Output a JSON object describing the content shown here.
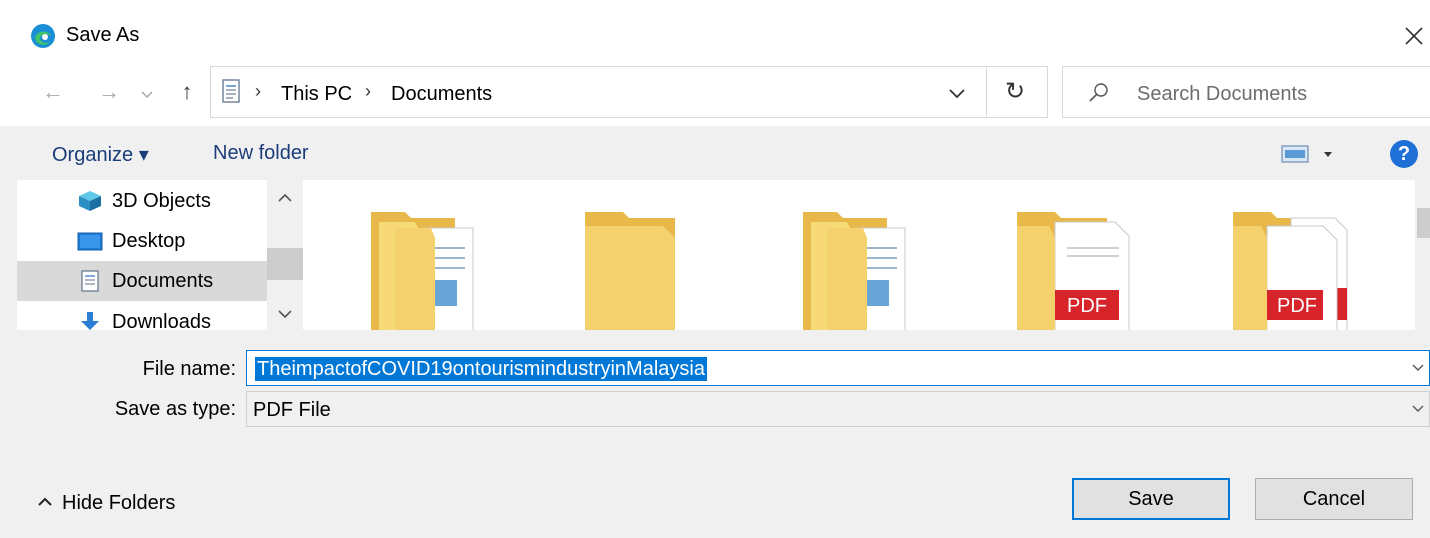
{
  "window": {
    "title": "Save As"
  },
  "nav": {
    "path": [
      "This PC",
      "Documents"
    ],
    "search_placeholder": "Search Documents"
  },
  "toolbar": {
    "organize_label": "Organize ▾",
    "new_folder_label": "New folder",
    "help_label": "?"
  },
  "sidebar": {
    "items": [
      {
        "label": "3D Objects",
        "icon": "3d-objects-icon",
        "selected": false
      },
      {
        "label": "Desktop",
        "icon": "desktop-icon",
        "selected": false
      },
      {
        "label": "Documents",
        "icon": "documents-icon",
        "selected": true
      },
      {
        "label": "Downloads",
        "icon": "downloads-icon",
        "selected": false
      }
    ]
  },
  "files": {
    "items": [
      {
        "type": "folder-with-documents"
      },
      {
        "type": "empty-folder"
      },
      {
        "type": "folder-with-documents"
      },
      {
        "type": "folder-with-pdf",
        "badge": "PDF"
      },
      {
        "type": "folder-with-pdfs",
        "badge": "PDF"
      }
    ]
  },
  "form": {
    "file_name_label": "File name:",
    "file_name_value": "TheimpactofCOVID19ontourismindustryinMalaysia",
    "save_type_label": "Save as type:",
    "save_type_value": "PDF File"
  },
  "footer": {
    "hide_folders_label": "Hide Folders",
    "save_label": "Save",
    "cancel_label": "Cancel"
  },
  "colors": {
    "accent": "#0078d7",
    "link": "#1a3d7a",
    "folder": "#f5d16d"
  }
}
